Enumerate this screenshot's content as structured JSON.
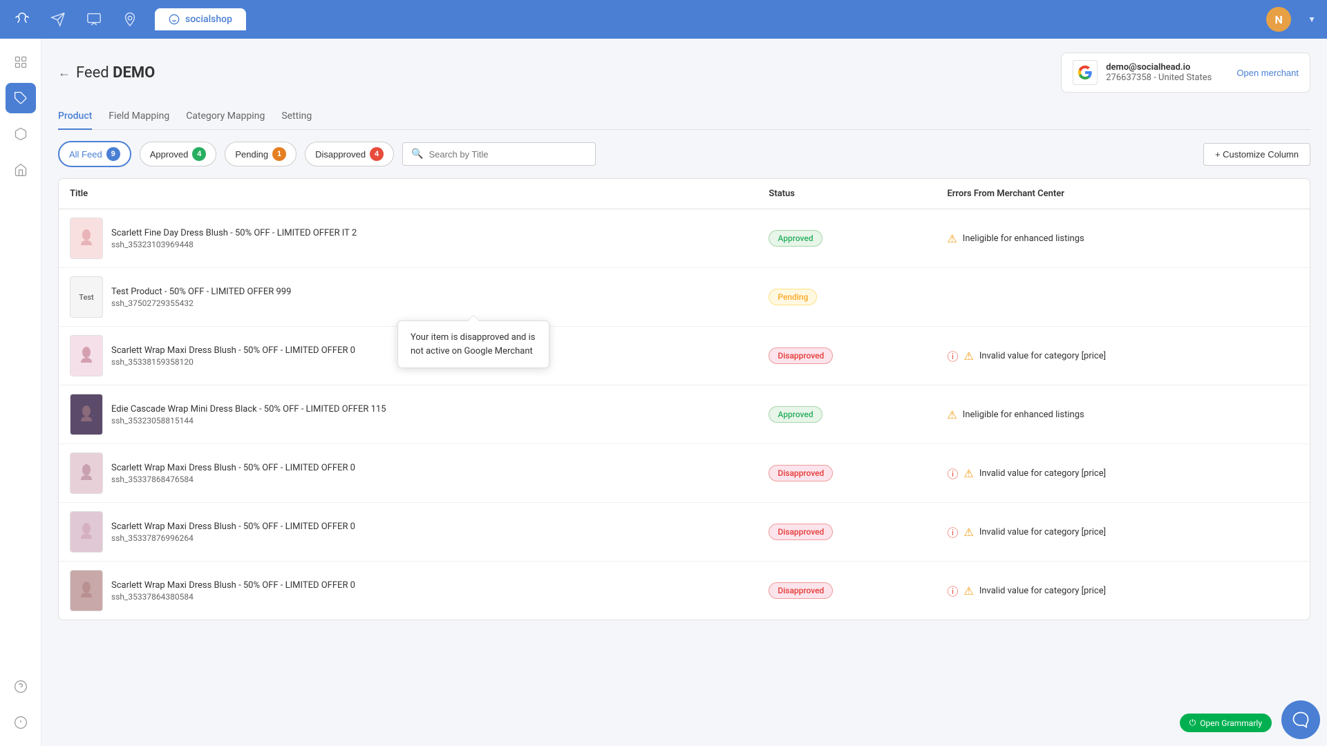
{
  "topNav": {
    "appName": "socialshop",
    "avatarInitial": "N",
    "icons": [
      "antler-icon",
      "paper-plane-icon",
      "chat-icon",
      "location-icon"
    ]
  },
  "sidebar": {
    "items": [
      {
        "name": "grid-icon",
        "label": "Dashboard",
        "active": false
      },
      {
        "name": "tag-icon",
        "label": "Tags",
        "active": true
      },
      {
        "name": "box-icon",
        "label": "Box",
        "active": false
      },
      {
        "name": "shop-icon",
        "label": "Shop",
        "active": false
      }
    ],
    "bottomItems": [
      {
        "name": "support-icon",
        "label": "Support",
        "active": false
      },
      {
        "name": "help-icon",
        "label": "Help",
        "active": false
      }
    ]
  },
  "page": {
    "backLabel": "←",
    "titlePrefix": "Feed",
    "titleMain": "DEMO"
  },
  "merchant": {
    "email": "demo@socialhead.io",
    "id": "276637358 - United States",
    "openLabel": "Open merchant"
  },
  "tabs": [
    {
      "id": "product",
      "label": "Product",
      "active": true
    },
    {
      "id": "field-mapping",
      "label": "Field Mapping",
      "active": false
    },
    {
      "id": "category-mapping",
      "label": "Category Mapping",
      "active": false
    },
    {
      "id": "setting",
      "label": "Setting",
      "active": false
    }
  ],
  "filters": [
    {
      "id": "all",
      "label": "All Feed",
      "count": 9,
      "badgeType": "blue",
      "active": true
    },
    {
      "id": "approved",
      "label": "Approved",
      "count": 4,
      "badgeType": "green",
      "active": false
    },
    {
      "id": "pending",
      "label": "Pending",
      "count": 1,
      "badgeType": "orange",
      "active": false
    },
    {
      "id": "disapproved",
      "label": "Disapproved",
      "count": 4,
      "badgeType": "red",
      "active": false
    }
  ],
  "search": {
    "placeholder": "Search by Title"
  },
  "customizeBtn": "+ Customize Column",
  "tableColumns": [
    "Title",
    "Status",
    "Errors From Merchant Center"
  ],
  "tooltip": {
    "text": "Your item is disapproved and is not active on Google Merchant"
  },
  "products": [
    {
      "id": 1,
      "title": "Scarlett Fine Day Dress Blush - 50% OFF - LIMITED OFFER IT 2",
      "sku": "ssh_35323103969448",
      "status": "Approved",
      "statusType": "approved",
      "errors": "Ineligible for enhanced listings",
      "hasWarning": true,
      "hasError": false,
      "thumb": "dress1"
    },
    {
      "id": 2,
      "title": "Test Product - 50% OFF - LIMITED OFFER 999",
      "sku": "ssh_37502729355432",
      "status": "Pending",
      "statusType": "pending",
      "errors": "",
      "hasWarning": false,
      "hasError": false,
      "thumb": "test"
    },
    {
      "id": 3,
      "title": "Scarlett Wrap Maxi Dress Blush - 50% OFF - LIMITED OFFER 0",
      "sku": "ssh_35338159358120",
      "status": "Disapproved",
      "statusType": "disapproved",
      "errors": "Invalid value for category [price]",
      "hasWarning": true,
      "hasError": true,
      "thumb": "dress3"
    },
    {
      "id": 4,
      "title": "Edie Cascade Wrap Mini Dress Black - 50% OFF - LIMITED OFFER 115",
      "sku": "ssh_35323058815144",
      "status": "Approved",
      "statusType": "approved",
      "errors": "Ineligible for enhanced listings",
      "hasWarning": true,
      "hasError": false,
      "thumb": "dress4"
    },
    {
      "id": 5,
      "title": "Scarlett Wrap Maxi Dress Blush - 50% OFF - LIMITED OFFER 0",
      "sku": "ssh_35337868476584",
      "status": "Disapproved",
      "statusType": "disapproved",
      "errors": "Invalid value for category [price]",
      "hasWarning": true,
      "hasError": true,
      "thumb": "dress5"
    },
    {
      "id": 6,
      "title": "Scarlett Wrap Maxi Dress Blush - 50% OFF - LIMITED OFFER 0",
      "sku": "ssh_35337876996264",
      "status": "Disapproved",
      "statusType": "disapproved",
      "errors": "Invalid value for category [price]",
      "hasWarning": true,
      "hasError": true,
      "thumb": "dress6"
    },
    {
      "id": 7,
      "title": "Scarlett Wrap Maxi Dress Blush - 50% OFF - LIMITED OFFER 0",
      "sku": "ssh_35337864380584",
      "status": "Disapproved",
      "statusType": "disapproved",
      "errors": "Invalid value for category [price]",
      "hasWarning": true,
      "hasError": true,
      "thumb": "dress7"
    }
  ],
  "grammarly": {
    "label": "Open Grammarly"
  }
}
